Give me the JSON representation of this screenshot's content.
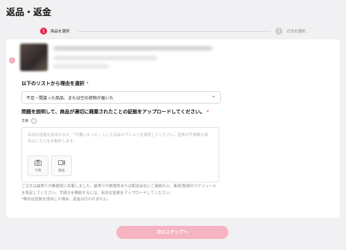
{
  "page": {
    "title": "返品・返金"
  },
  "stepper": {
    "steps": [
      {
        "number": "1",
        "label": "商品を選択"
      },
      {
        "number": "2",
        "label": "方法を選択"
      }
    ]
  },
  "reason": {
    "label": "以下のリストから理由を選択",
    "required_mark": "*",
    "selected": "不足・間違った商品、または空の荷物が届いた"
  },
  "evidence": {
    "label": "問題を説明して、商品が適切に廃棄されたことの証拠をアップロードしてください。",
    "required_mark": "*",
    "handling_label": "手順",
    "info_icon": "i",
    "placeholder": "有効な証拠を提出するか、「不要になった」として返品オプションを選択してください。証拠が不明瞭な場合はこちらをお勧めします。",
    "photo_label": "写真",
    "video_label": "動画"
  },
  "notice": {
    "text": "ご注文は最寄りの郵便局に到着しました。最寄りの郵便局または配送会社にご連絡の上、集荷/配達のスケジュールを設定してください。手続きを開始するには、有効な証拠をアップロードしてください。",
    "note": "*無効な証拠を提出した場合、返金は行われません。"
  },
  "footer": {
    "next_label": "次のステップへ"
  },
  "colors": {
    "accent": "#e0234b",
    "button_disabled": "#f6b3c1"
  }
}
